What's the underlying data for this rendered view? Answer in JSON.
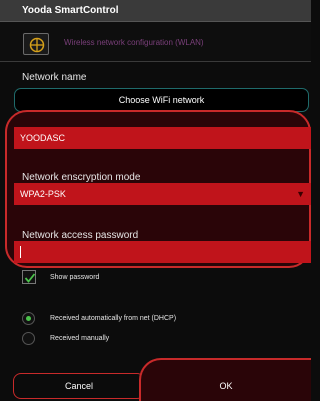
{
  "window": {
    "title": "Yooda SmartControl"
  },
  "header": {
    "text": "Wireless network configuration (WLAN)",
    "icon": "network-config-icon"
  },
  "network": {
    "label": "Network name",
    "choose_button": "Choose WiFi network",
    "ssid_value": "YOODASC"
  },
  "encryption": {
    "label": "Network enscryption mode",
    "selected": "WPA2-PSK"
  },
  "password": {
    "label": "Network access password",
    "value": ""
  },
  "show_password": {
    "label": "Show password",
    "checked": true
  },
  "ip_mode": {
    "options": [
      {
        "label": "Received automatically from net (DHCP)",
        "selected": true
      },
      {
        "label": "Received manually",
        "selected": false
      }
    ]
  },
  "buttons": {
    "cancel": "Cancel",
    "ok": "OK"
  },
  "colors": {
    "accent_red": "#c0141b",
    "outline_red": "#c82a2a",
    "check_green": "#4cc24c",
    "teal_border": "#1f6b6b"
  }
}
